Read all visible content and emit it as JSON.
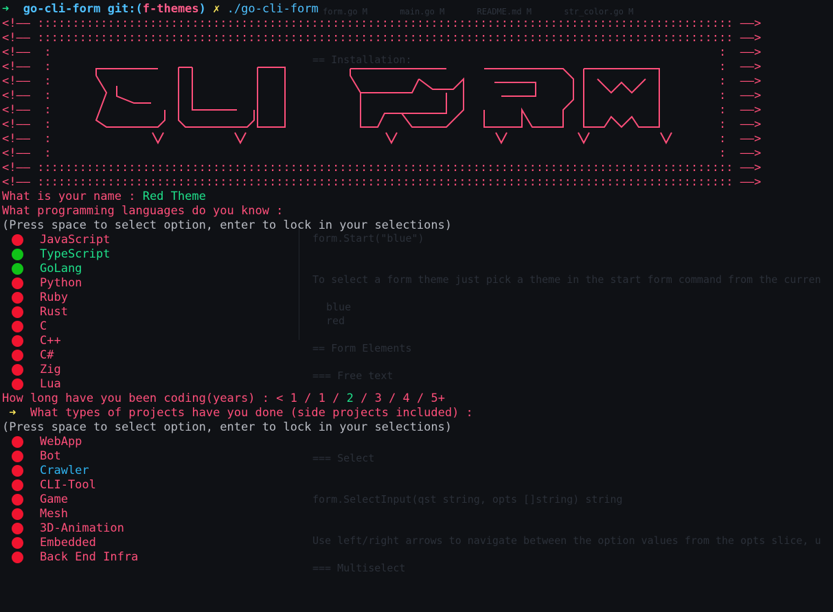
{
  "prompt": {
    "arrow": "➜",
    "dir": "go-cli-form",
    "git_prefix": "git:(",
    "branch": "f-themes",
    "git_suffix": ")",
    "dirty": "✗",
    "command": "./go-cli-form"
  },
  "banner": {
    "left_edge": "<!——",
    "right_edge": "——>",
    "fill_char": ":",
    "art_words": [
      "CLI",
      "FORM"
    ]
  },
  "form": {
    "name_question": "What is your name : ",
    "name_answer": "Red Theme",
    "languages_question": "What programming languages do you know :",
    "hint": "(Press space to select option, enter to lock in your selections)",
    "languages": [
      {
        "label": "JavaScript",
        "selected": false
      },
      {
        "label": "TypeScript",
        "selected": true
      },
      {
        "label": "GoLang",
        "selected": true
      },
      {
        "label": "Python",
        "selected": false
      },
      {
        "label": "Ruby",
        "selected": false
      },
      {
        "label": "Rust",
        "selected": false
      },
      {
        "label": "C",
        "selected": false
      },
      {
        "label": "C++",
        "selected": false
      },
      {
        "label": "C#",
        "selected": false
      },
      {
        "label": "Zig",
        "selected": false
      },
      {
        "label": "Lua",
        "selected": false
      }
    ],
    "years_question": "How long have you been coding(years) : ",
    "years_open": "<",
    "years_options": [
      "1",
      "1",
      "2",
      "3",
      "4",
      "5+"
    ],
    "years_selected_index": 2,
    "years_separator": " / ",
    "projects_marker": "➜",
    "projects_question": "What types of projects have you done (side projects included) :",
    "hint2": "(Press space to select option, enter to lock in your selections)",
    "projects": [
      {
        "label": "WebApp",
        "cursor": false
      },
      {
        "label": "Bot",
        "cursor": false
      },
      {
        "label": "Crawler",
        "cursor": true
      },
      {
        "label": "CLI-Tool",
        "cursor": false
      },
      {
        "label": "Game",
        "cursor": false
      },
      {
        "label": "Mesh",
        "cursor": false
      },
      {
        "label": "3D-Animation",
        "cursor": false
      },
      {
        "label": "Embedded",
        "cursor": false
      },
      {
        "label": "Back End Infra",
        "cursor": false
      }
    ]
  },
  "colors": {
    "accent_red": "#ff4f7a",
    "selected_green": "#10c218",
    "unselected_red": "#f0142f",
    "cursor_blue": "#2fb3f0",
    "answer_green": "#1fe08a"
  },
  "background_editor": {
    "tabs": [
      "form.go M",
      "main.go M",
      "README.md M",
      "str_color.go M"
    ],
    "lines": [
      "== Installation:",
      "To select a form theme just pick a theme in the start form command from the curren",
      "blue",
      "red",
      "== Form Elements",
      "=== Free text",
      "=== Select",
      "form.SelectInput(qst string, opts []string) string",
      "Use left/right arrows to navigate between the option values from the opts slice, u",
      "=== Multiselect",
      "form.Start(\"blue\")"
    ]
  }
}
